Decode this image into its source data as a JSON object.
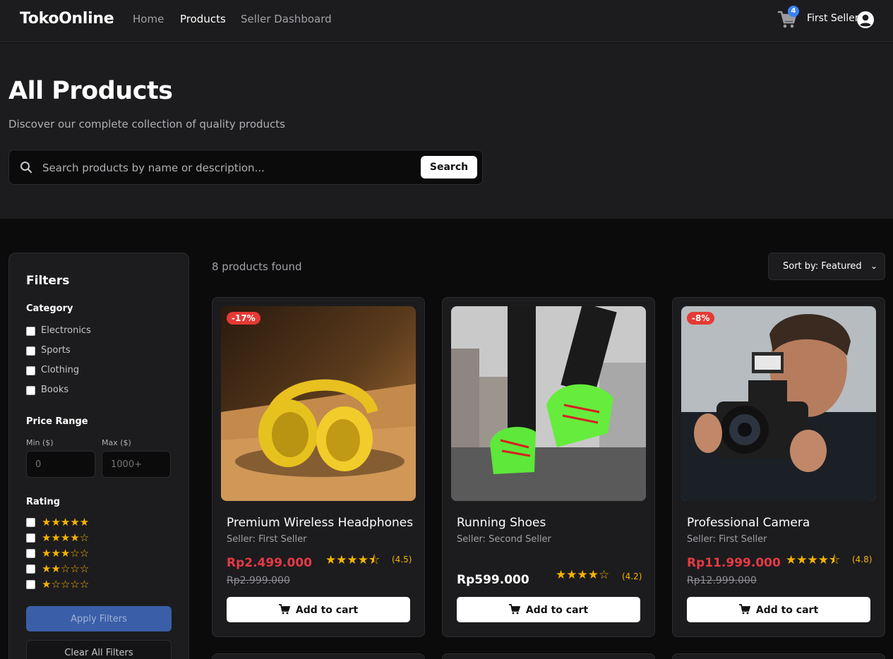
{
  "header": {
    "brand": "TokoOnline",
    "nav": [
      "Home",
      "Products",
      "Seller Dashboard"
    ],
    "cart_count": "4",
    "user_name": "First Seller"
  },
  "hero": {
    "title": "All Products",
    "subtitle": "Discover our complete collection of quality products",
    "search_placeholder": "Search products by name or description...",
    "search_button": "Search"
  },
  "filters": {
    "title": "Filters",
    "category_label": "Category",
    "categories": [
      "Electronics",
      "Sports",
      "Clothing",
      "Books"
    ],
    "price_label": "Price Range",
    "min_label": "Min ($)",
    "max_label": "Max ($)",
    "min_placeholder": "0",
    "max_placeholder": "1000+",
    "rating_label": "Rating",
    "rating_options": [
      "★★★★★",
      "★★★★☆",
      "★★★☆☆",
      "★★☆☆☆",
      "★☆☆☆☆"
    ],
    "apply_button": "Apply Filters",
    "clear_button": "Clear All Filters"
  },
  "results": {
    "count_text": "8 products found",
    "sort_label": "Sort by: Featured"
  },
  "products": [
    {
      "badge": "-17%",
      "name": "Premium Wireless Headphones",
      "seller": "Seller: First Seller",
      "price": "Rp2.499.000",
      "old_price": "Rp2.999.000",
      "stars": "★★★★⯪",
      "rating": "(4.5)",
      "button": "Add to cart"
    },
    {
      "badge": "",
      "name": "Running Shoes",
      "seller": "Seller: Second Seller",
      "price": "Rp599.000",
      "old_price": "",
      "stars": "★★★★☆",
      "rating": "(4.2)",
      "button": "Add to cart"
    },
    {
      "badge": "-8%",
      "name": "Professional Camera",
      "seller": "Seller: First Seller",
      "price": "Rp11.999.000",
      "old_price": "Rp12.999.000",
      "stars": "★★★★⯪",
      "rating": "(4.8)",
      "button": "Add to cart"
    }
  ]
}
